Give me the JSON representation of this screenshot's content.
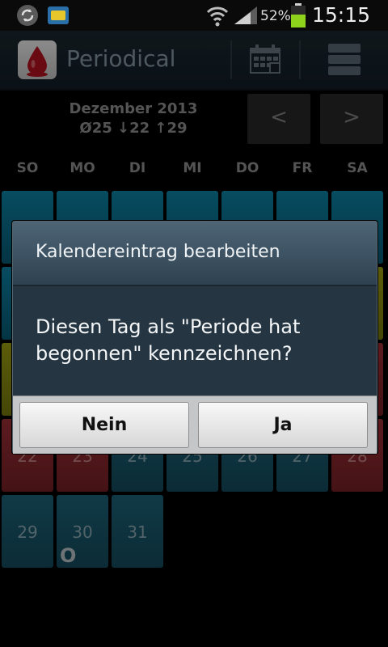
{
  "status_bar": {
    "battery_percent": "52%",
    "time": "15:15",
    "icons": [
      "sync-icon",
      "sim-icon",
      "wifi-icon",
      "signal-icon",
      "battery-icon"
    ]
  },
  "action_bar": {
    "title": "Periodical",
    "icons": [
      "blood-drop-icon",
      "calendar-icon",
      "list-icon"
    ]
  },
  "calendar": {
    "month_title": "Dezember 2013",
    "cycle_stats": "Ø25 ↓22 ↑29",
    "prev_label": "<",
    "next_label": ">",
    "weekdays": [
      "SO",
      "MO",
      "DI",
      "MI",
      "DO",
      "FR",
      "SA"
    ],
    "visible_days": [
      "22",
      "23",
      "24",
      "25",
      "26",
      "27",
      "28",
      "29",
      "30",
      "31"
    ],
    "day30_marker": "O",
    "colors": {
      "cycle_day": "#0d8bb0",
      "period_day": "#a7333b",
      "fertile_day": "#a6aa12"
    }
  },
  "dialog": {
    "title": "Kalendereintrag bearbeiten",
    "message": "Diesen Tag als \"Periode hat begonnen\" kennzeichnen?",
    "no_label": "Nein",
    "yes_label": "Ja"
  }
}
